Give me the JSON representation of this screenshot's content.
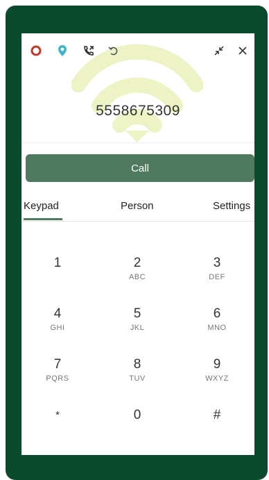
{
  "dialer": {
    "number": "5558675309",
    "call_label": "Call"
  },
  "tabs": [
    {
      "label": "Keypad",
      "active": true
    },
    {
      "label": "Person",
      "active": false
    },
    {
      "label": "Settings",
      "active": false
    }
  ],
  "keypad": [
    {
      "digit": "1",
      "letters": ""
    },
    {
      "digit": "2",
      "letters": "ABC"
    },
    {
      "digit": "3",
      "letters": "DEF"
    },
    {
      "digit": "4",
      "letters": "GHI"
    },
    {
      "digit": "5",
      "letters": "JKL"
    },
    {
      "digit": "6",
      "letters": "MNO"
    },
    {
      "digit": "7",
      "letters": "PQRS"
    },
    {
      "digit": "8",
      "letters": "TUV"
    },
    {
      "digit": "9",
      "letters": "WXYZ"
    },
    {
      "digit": "*",
      "letters": ""
    },
    {
      "digit": "0",
      "letters": ""
    },
    {
      "digit": "#",
      "letters": ""
    }
  ],
  "toolbar_icons": [
    "record-icon",
    "location-pin-icon",
    "call-transfer-icon",
    "undo-icon",
    "minimize-icon",
    "close-icon"
  ],
  "colors": {
    "frame": "#0c4a2e",
    "accent": "#4f7a60",
    "record": "#c0392b",
    "location": "#3fb5c8",
    "watermark": "#eef3c6"
  }
}
